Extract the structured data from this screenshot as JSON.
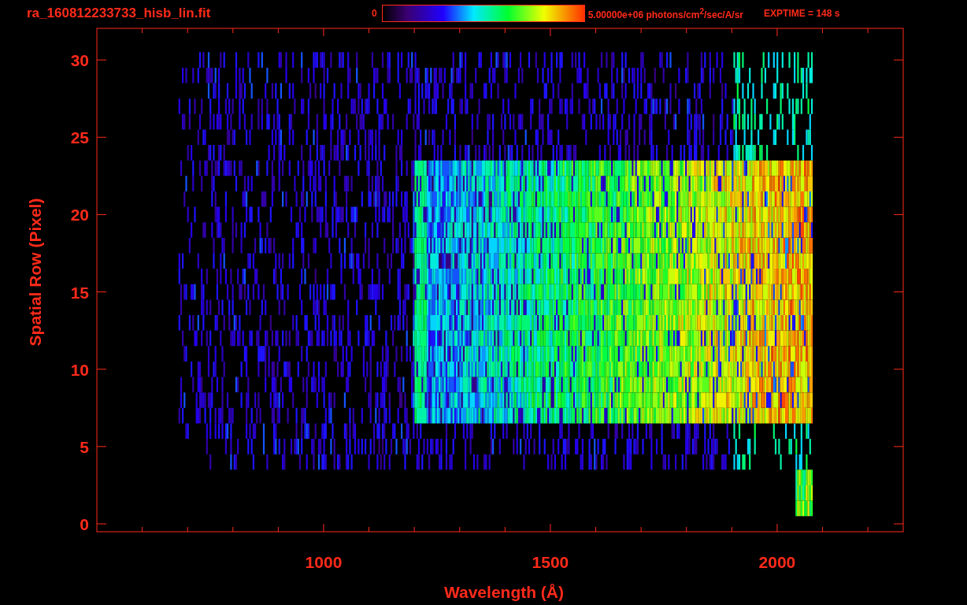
{
  "title": "ra_160812233733_hisb_lin.fit",
  "colorbar": {
    "min_label": "0",
    "max_label": "5.00000e+06 photons/cm$^{2}$/sec/A/sr"
  },
  "exptime": "EXPTIME = 148 s",
  "x_axis": {
    "label": "Wavelength (Å)",
    "ticks": [
      "1000",
      "1500",
      "2000"
    ]
  },
  "y_axis": {
    "label": "Spatial Row (Pixel)",
    "ticks": [
      "30",
      "25",
      "20",
      "15",
      "10",
      "5",
      "0"
    ]
  }
}
